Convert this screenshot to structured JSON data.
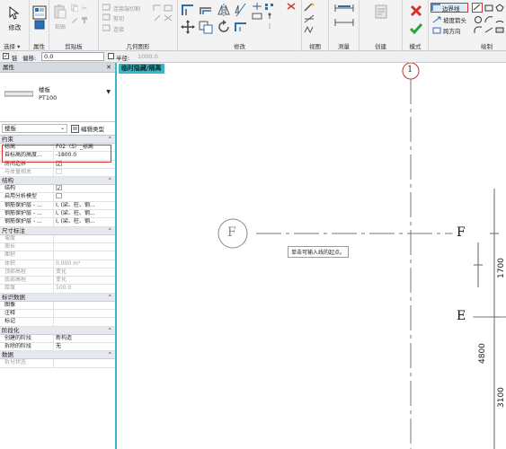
{
  "ribbon": {
    "modify_label": "修改",
    "select_label": "选择",
    "properties_label": "属性",
    "clipboard_label": "剪贴板",
    "paste_label": "粘贴",
    "cut_join_label": "连接端切割",
    "cut_label": "剪切",
    "join_label": "连接",
    "geometry_label": "几何图形",
    "modify_panel_label": "修改",
    "view_label": "视图",
    "measure_label": "测量",
    "create_label": "创建",
    "mode_label": "模式",
    "draw_label": "绘制",
    "boundary_line_label": "边界线",
    "slope_arrow_label": "坡度箭头",
    "span_direction_label": "跨方向"
  },
  "options_bar": {
    "chain_label": "链",
    "offset_label": "偏移:",
    "offset_value": "0.0",
    "radius_label": "半径:",
    "radius_value": "1000.0"
  },
  "properties": {
    "title": "属性",
    "family": "楼板",
    "type": "PT100",
    "instance_filter": "楼板",
    "edit_type_label": "编辑类型",
    "sections": [
      {
        "title": "约束",
        "rows": [
          {
            "key": "标高",
            "value": "F02（S）_标高"
          },
          {
            "key": "自标高的高度...",
            "value": "-1800.0"
          },
          {
            "key": "房间边界",
            "value": "☑"
          },
          {
            "key": "与体量相关",
            "value": "☐"
          }
        ]
      },
      {
        "title": "结构",
        "rows": [
          {
            "key": "结构",
            "value": "☑"
          },
          {
            "key": "启用分析模型",
            "value": "☐"
          },
          {
            "key": "钢筋保护层 - ...",
            "value": "I, (梁、柱、钢..."
          },
          {
            "key": "钢筋保护层 - ...",
            "value": "I, (梁、柱、钢..."
          },
          {
            "key": "钢筋保护层 - ...",
            "value": "I, (梁、柱、钢..."
          }
        ]
      },
      {
        "title": "尺寸标注",
        "rows": [
          {
            "key": "坡度",
            "value": ""
          },
          {
            "key": "周长",
            "value": ""
          },
          {
            "key": "面积",
            "value": ""
          },
          {
            "key": "体积",
            "value": "0.000 m³"
          },
          {
            "key": "顶部高程",
            "value": "变化"
          },
          {
            "key": "底部高程",
            "value": "变化"
          },
          {
            "key": "厚度",
            "value": "100.0"
          }
        ]
      },
      {
        "title": "标识数据",
        "rows": [
          {
            "key": "图像",
            "value": ""
          },
          {
            "key": "注释",
            "value": ""
          },
          {
            "key": "标记",
            "value": ""
          }
        ]
      },
      {
        "title": "阶段化",
        "rows": [
          {
            "key": "创建的阶段",
            "value": "新构造"
          },
          {
            "key": "拆除的阶段",
            "value": "无"
          }
        ]
      },
      {
        "title": "数据",
        "rows": [
          {
            "key": "拆分状态",
            "value": ""
          }
        ]
      }
    ]
  },
  "canvas": {
    "view_tab": "临时隐藏/隔离",
    "grid_top": "1",
    "grid_f_left": "F",
    "grid_f_right": "F",
    "grid_e": "E",
    "tooltip": "单击可输入线的起点。",
    "dim_1700": "1700",
    "dim_4800": "4800",
    "dim_3100": "3100"
  },
  "colors": {
    "accent": "#3eb6c3",
    "highlight_box": "#d9302c",
    "grid": "#777777"
  }
}
